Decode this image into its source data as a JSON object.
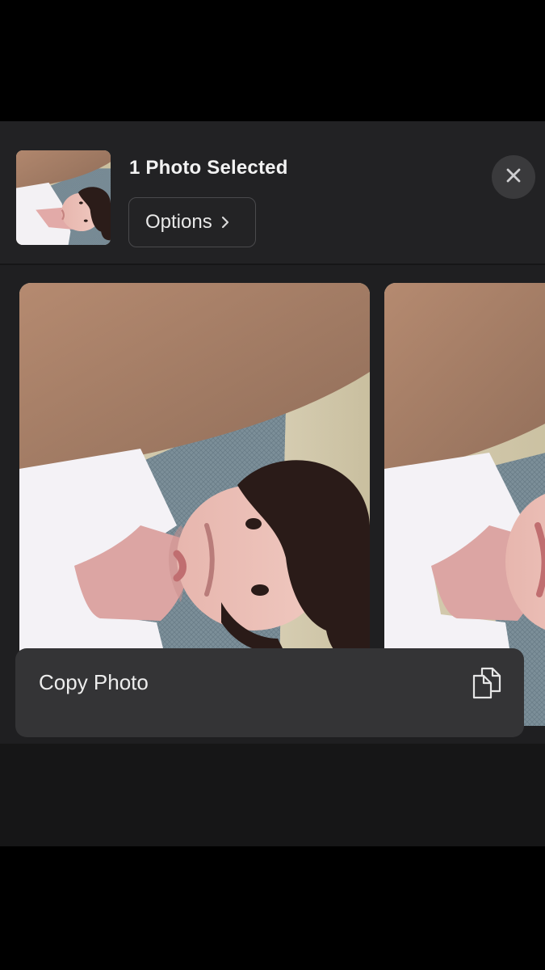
{
  "header": {
    "title": "1 Photo Selected",
    "options_label": "Options"
  },
  "icons": {
    "close": "close-icon",
    "options_chevron": "chevron-right-icon",
    "copy": "copy-icon"
  },
  "actions": [
    {
      "label": "Copy Photo",
      "icon": "copy-icon"
    }
  ],
  "colors": {
    "sheet_background": "#1f1f21",
    "action_row_background": "#343436",
    "close_button_background": "#3a3a3c"
  }
}
